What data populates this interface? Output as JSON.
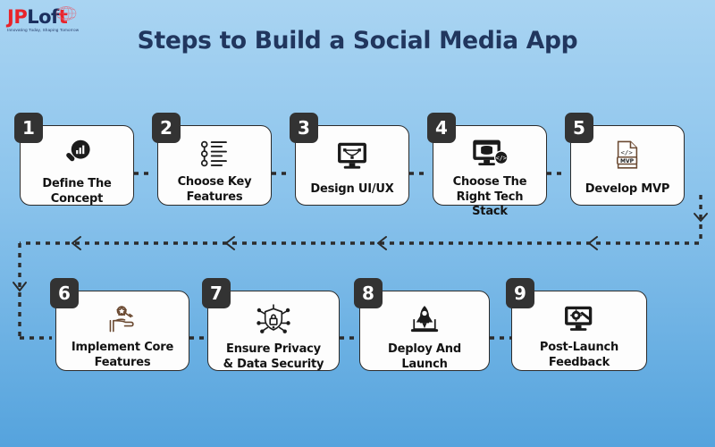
{
  "brand": {
    "name_part1": "JP",
    "name_part2": "L",
    "name_part3": "o",
    "name_part4": "f",
    "name_part5": "t",
    "tagline": "Innovating Today, Shaping Tomorrow",
    "color_red": "#e8232a",
    "color_navy": "#1b2f5e",
    "globe_icon": "globe-icon"
  },
  "header": {
    "title": "Steps to Build a Social Media App",
    "title_color": "#21365e"
  },
  "theme": {
    "background_top": "#a9d4f2",
    "background_bottom": "#55a3dd",
    "card_background": "#fdfdfd",
    "card_border": "#2b2b2b",
    "badge_background": "#333333",
    "badge_text": "#ffffff",
    "connector_color": "#2b2b2b",
    "icon_dark": "#1b1b1b",
    "icon_brown": "#6b4a32"
  },
  "steps": [
    {
      "number": "1",
      "label": "Define The\nConcept",
      "label_line1": "Define The",
      "label_line2": "Concept",
      "icon": "magnifier-bar-chart-icon"
    },
    {
      "number": "2",
      "label": "Choose Key\nFeatures",
      "label_line1": "Choose Key",
      "label_line2": "Features",
      "icon": "checklist-icon"
    },
    {
      "number": "3",
      "label": "Design UI/UX",
      "label_line1": "Design UI/UX",
      "label_line2": "",
      "icon": "monitor-pen-tool-icon"
    },
    {
      "number": "4",
      "label": "Choose The\nRight Tech Stack",
      "label_line1": "Choose The",
      "label_line2": "Right Tech Stack",
      "icon": "monitor-database-code-icon"
    },
    {
      "number": "5",
      "label": "Develop MVP",
      "label_line1": "Develop MVP",
      "label_line2": "",
      "icon": "mvp-code-file-icon",
      "icon_badge_text": "MVP"
    },
    {
      "number": "6",
      "label": "Implement Core\nFeatures",
      "label_line1": "Implement Core",
      "label_line2": "Features",
      "icon": "hand-gear-wrench-icon"
    },
    {
      "number": "7",
      "label": "Ensure Privacy\n& Data Security",
      "label_line1": "Ensure Privacy",
      "label_line2": "& Data Security",
      "icon": "shield-lock-circuit-icon"
    },
    {
      "number": "8",
      "label": "Deploy And\nLaunch",
      "label_line1": "Deploy And",
      "label_line2": "Launch",
      "icon": "rocket-laptop-icon"
    },
    {
      "number": "9",
      "label": "Post-Launch\nFeedback",
      "label_line1": "Post-Launch",
      "label_line2": "Feedback",
      "icon": "monitor-gear-wrench-icon"
    }
  ],
  "flow": {
    "direction_row1": "left-to-right",
    "direction_return": "right-to-left",
    "arrow_icon": "chevron-arrow-icon"
  }
}
